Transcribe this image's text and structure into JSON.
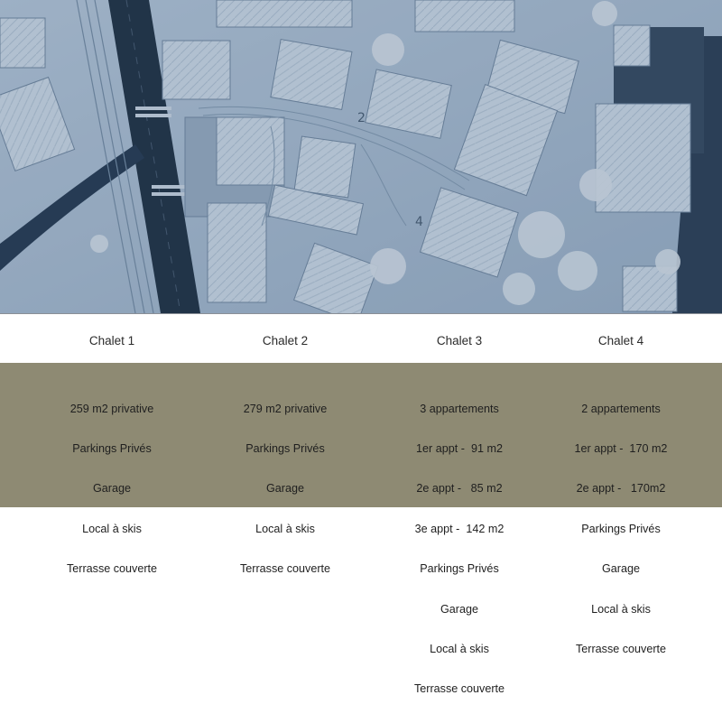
{
  "chalets": [
    {
      "title": "Chalet 1",
      "lines": [
        "259 m2 privative",
        "Parkings Privés",
        "Garage",
        "Local à skis",
        "Terrasse couverte"
      ]
    },
    {
      "title": "Chalet 2",
      "lines": [
        "279 m2 privative",
        "Parkings Privés",
        "Garage",
        "Local à skis",
        "Terrasse couverte"
      ]
    },
    {
      "title": "Chalet 3",
      "lines": [
        "3 appartements",
        "1er appt -  91 m2",
        "2e appt -   85 m2",
        "3e appt -  142 m2",
        "Parkings Privés",
        "Garage",
        "Local à skis",
        "Terrasse couverte"
      ]
    },
    {
      "title": "Chalet 4",
      "lines": [
        "2 appartements",
        "1er appt -  170 m2",
        "2e appt -   170m2",
        "Parkings Privés",
        "Garage",
        "Local à skis",
        "Terrasse couverte"
      ]
    }
  ],
  "aerial_markers": [
    "2",
    "4"
  ],
  "colors": {
    "panel": "#8e8a73",
    "title_strip": "#ffffff",
    "photo_tint": "#2f4e6e"
  }
}
